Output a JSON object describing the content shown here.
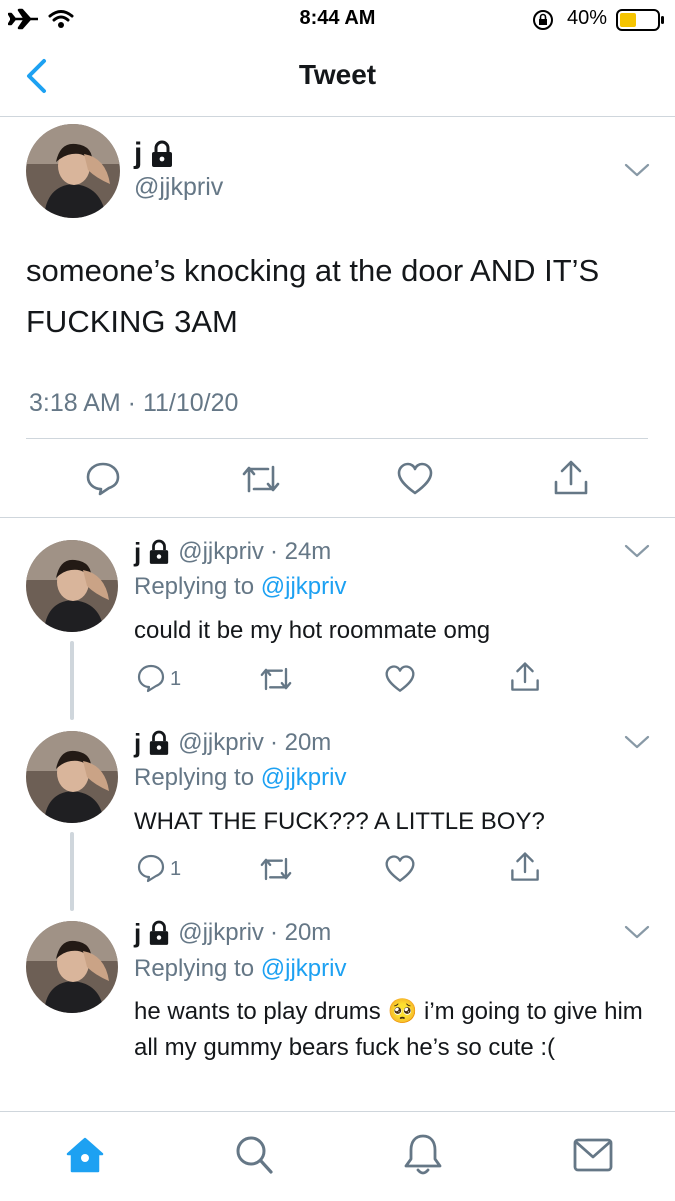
{
  "status_bar": {
    "time": "8:44 AM",
    "battery": "40%"
  },
  "nav": {
    "title": "Tweet"
  },
  "main_tweet": {
    "name": "j",
    "handle": "@jjkpriv",
    "text": "someone’s knocking at the door AND IT’S FUCKING 3AM",
    "timestamp": "3:18 AM · 11/10/20"
  },
  "replies": [
    {
      "name": "j",
      "handle": "@jjkpriv",
      "time": "· 24m",
      "replying_label": "Replying to",
      "replying_to": "@jjkpriv",
      "text": "could it be my hot roommate omg",
      "reply_count": "1"
    },
    {
      "name": "j",
      "handle": "@jjkpriv",
      "time": "· 20m",
      "replying_label": "Replying to",
      "replying_to": "@jjkpriv",
      "text": "WHAT THE FUCK??? A LITTLE BOY?",
      "reply_count": "1"
    },
    {
      "name": "j",
      "handle": "@jjkpriv",
      "time": "· 20m",
      "replying_label": "Replying to",
      "replying_to": "@jjkpriv",
      "text": "he wants to play drums 🥺 i’m going to give him all my gummy bears fuck he’s so cute :("
    }
  ],
  "icons": {
    "back": "chevron-left-icon",
    "reply": "speech-bubble-icon",
    "retweet": "retweet-icon",
    "like": "heart-icon",
    "share": "share-icon",
    "home": "home-icon",
    "search": "search-icon",
    "notifications": "bell-icon",
    "messages": "envelope-icon",
    "lock": "lock-icon",
    "caret": "chevron-down-icon"
  },
  "colors": {
    "accent": "#1da1f2",
    "text": "#14171a",
    "muted": "#657786",
    "divider": "#cfd6dc",
    "battery": "#f5c400"
  }
}
